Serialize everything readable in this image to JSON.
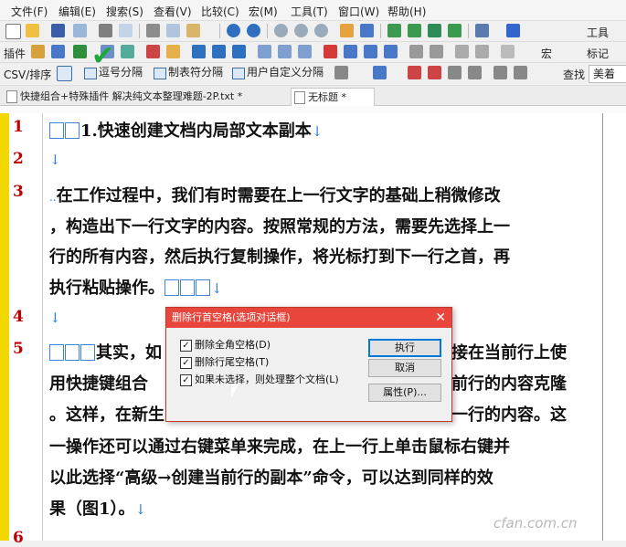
{
  "menu": [
    "文件(F)",
    "编辑(E)",
    "搜索(S)",
    "查看(V)",
    "比较(C)",
    "宏(M)",
    "工具(T)",
    "窗口(W)",
    "帮助(H)"
  ],
  "toolbar2": {
    "left_label": "插件",
    "right1": "宏",
    "right2": "标记"
  },
  "toolbar1": {
    "right_label": "工具"
  },
  "toolbar3": {
    "csv": "CSV/排序",
    "btn1": "逗号分隔",
    "btn2": "制表符分隔",
    "btn3": "用户自定义分隔",
    "find": "查找",
    "beauty": "美着"
  },
  "tabs": [
    "快捷组合+特殊插件 解决纯文本整理难题-2P.txt *",
    "无标题 *"
  ],
  "lines": {
    "l1_num": "1",
    "l1": "1.快速创建文档内局部文本副本",
    "l2_num": "2",
    "l3_num": "3",
    "l3a": "在工作过程中，我们有时需要在上一行文字的基础上稍微修改",
    "l3b": "，构造出下一行文字的内容。按照常规的方法，需要先选择上一",
    "l3c": "行的所有内容，然后执行复制操作，将光标打到下一行之首，再",
    "l3d": "执行粘贴操作。",
    "l4_num": "4",
    "l5_num": "5",
    "l5a_left": "其实，如",
    "l5a_right": "接在当前行上使",
    "l5b_left": "用快捷键组合",
    "l5b_right": "前行的内容克隆",
    "l5c_left": "。这样，在新生",
    "l5c_right": "一行的内容。这",
    "l5d": "一操作还可以通过右键菜单来完成，在上一行上单击鼠标右键并",
    "l5e": "以此选择“高级→创建当前行的副本”命令，可以达到同样的效",
    "l5f": "果（图1）。",
    "l6_num": "6"
  },
  "dialog": {
    "title": "删除行首空格(选项对话框)",
    "close": "✕",
    "opt1": "删除全角空格(D)",
    "opt2": "删除行尾空格(T)",
    "opt3": "如果未选择，则处理整个文档(L)",
    "ok": "执行",
    "cancel": "取消",
    "props": "属性(P)..."
  },
  "marks": {
    "arrow": "↓",
    "check": "✔",
    "box_check": "✓"
  },
  "watermark": "cfan.com.cn",
  "colors": {
    "line_number": "#c00000",
    "gutter": "#f2d700",
    "dialog_title": "#e8453c",
    "accent_check": "#1fa83a",
    "para_mark": "#2a7ad8"
  }
}
